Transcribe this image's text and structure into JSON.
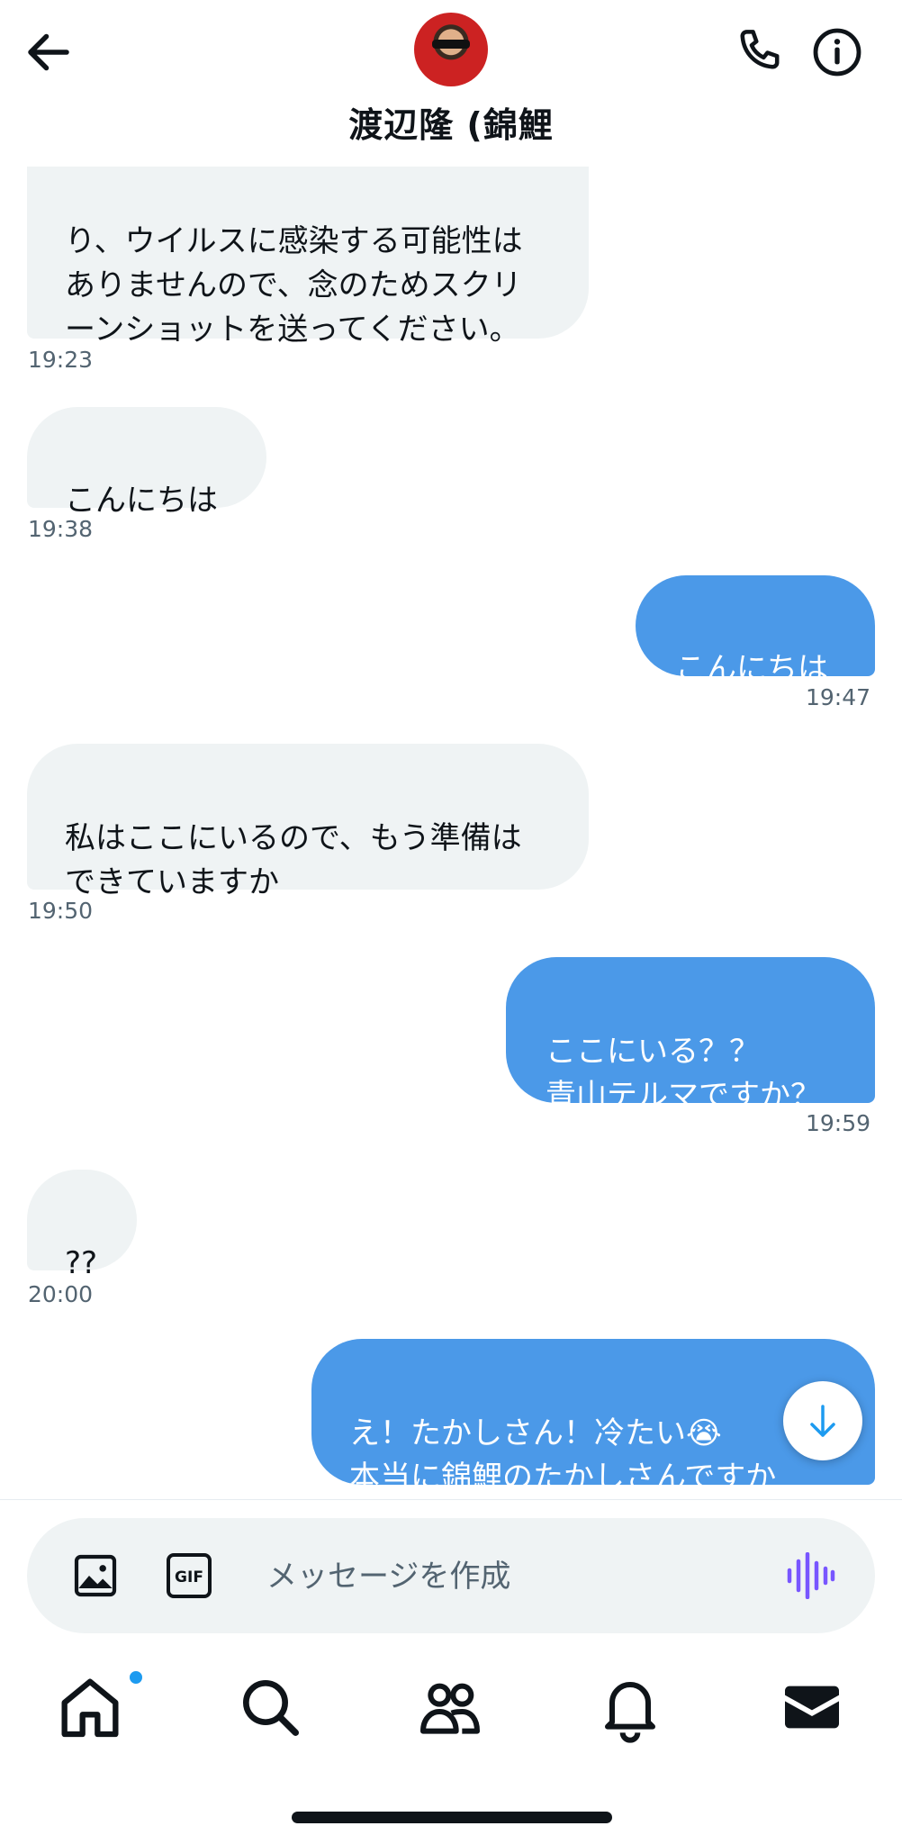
{
  "header": {
    "title": "渡辺隆 (錦鯉",
    "back_icon": "arrow-left-icon",
    "call_icon": "phone-icon",
    "info_icon": "info-icon"
  },
  "messages": [
    {
      "direction": "in",
      "text": "り、ウイルスに感染する可能性は\nありませんので、念のためスクリ\nーンショットを送ってください。",
      "time": "19:23"
    },
    {
      "direction": "in",
      "text": "こんにちは",
      "time": "19:38"
    },
    {
      "direction": "out",
      "text": "こんにちは",
      "time": "19:47"
    },
    {
      "direction": "in",
      "text": "私はここにいるので、もう準備は\nできていますか",
      "time": "19:50"
    },
    {
      "direction": "out",
      "text": "ここにいる？？\n青山テルマですか？",
      "time": "19:59"
    },
    {
      "direction": "in",
      "text": "??",
      "time": "20:00"
    },
    {
      "direction": "out",
      "text": "え！たかしさん！冷たい😭\n本当に錦鯉のたかしさんですか",
      "time": ""
    }
  ],
  "composer": {
    "placeholder": "メッセージを作成",
    "gif_label": "GIF",
    "image_icon": "image-icon",
    "voice_icon": "voice-waveform-icon"
  },
  "tabs": [
    {
      "name": "home",
      "icon": "home-icon",
      "has_notification_dot": true
    },
    {
      "name": "search",
      "icon": "search-icon"
    },
    {
      "name": "communities",
      "icon": "people-icon"
    },
    {
      "name": "notifications",
      "icon": "bell-icon"
    },
    {
      "name": "messages",
      "icon": "mail-icon",
      "active": true
    }
  ],
  "colors": {
    "outgoing_bubble": "#4b99e8",
    "incoming_bubble": "#eff3f4",
    "accent": "#1d9bf0",
    "voice_icon": "#7856ff"
  }
}
